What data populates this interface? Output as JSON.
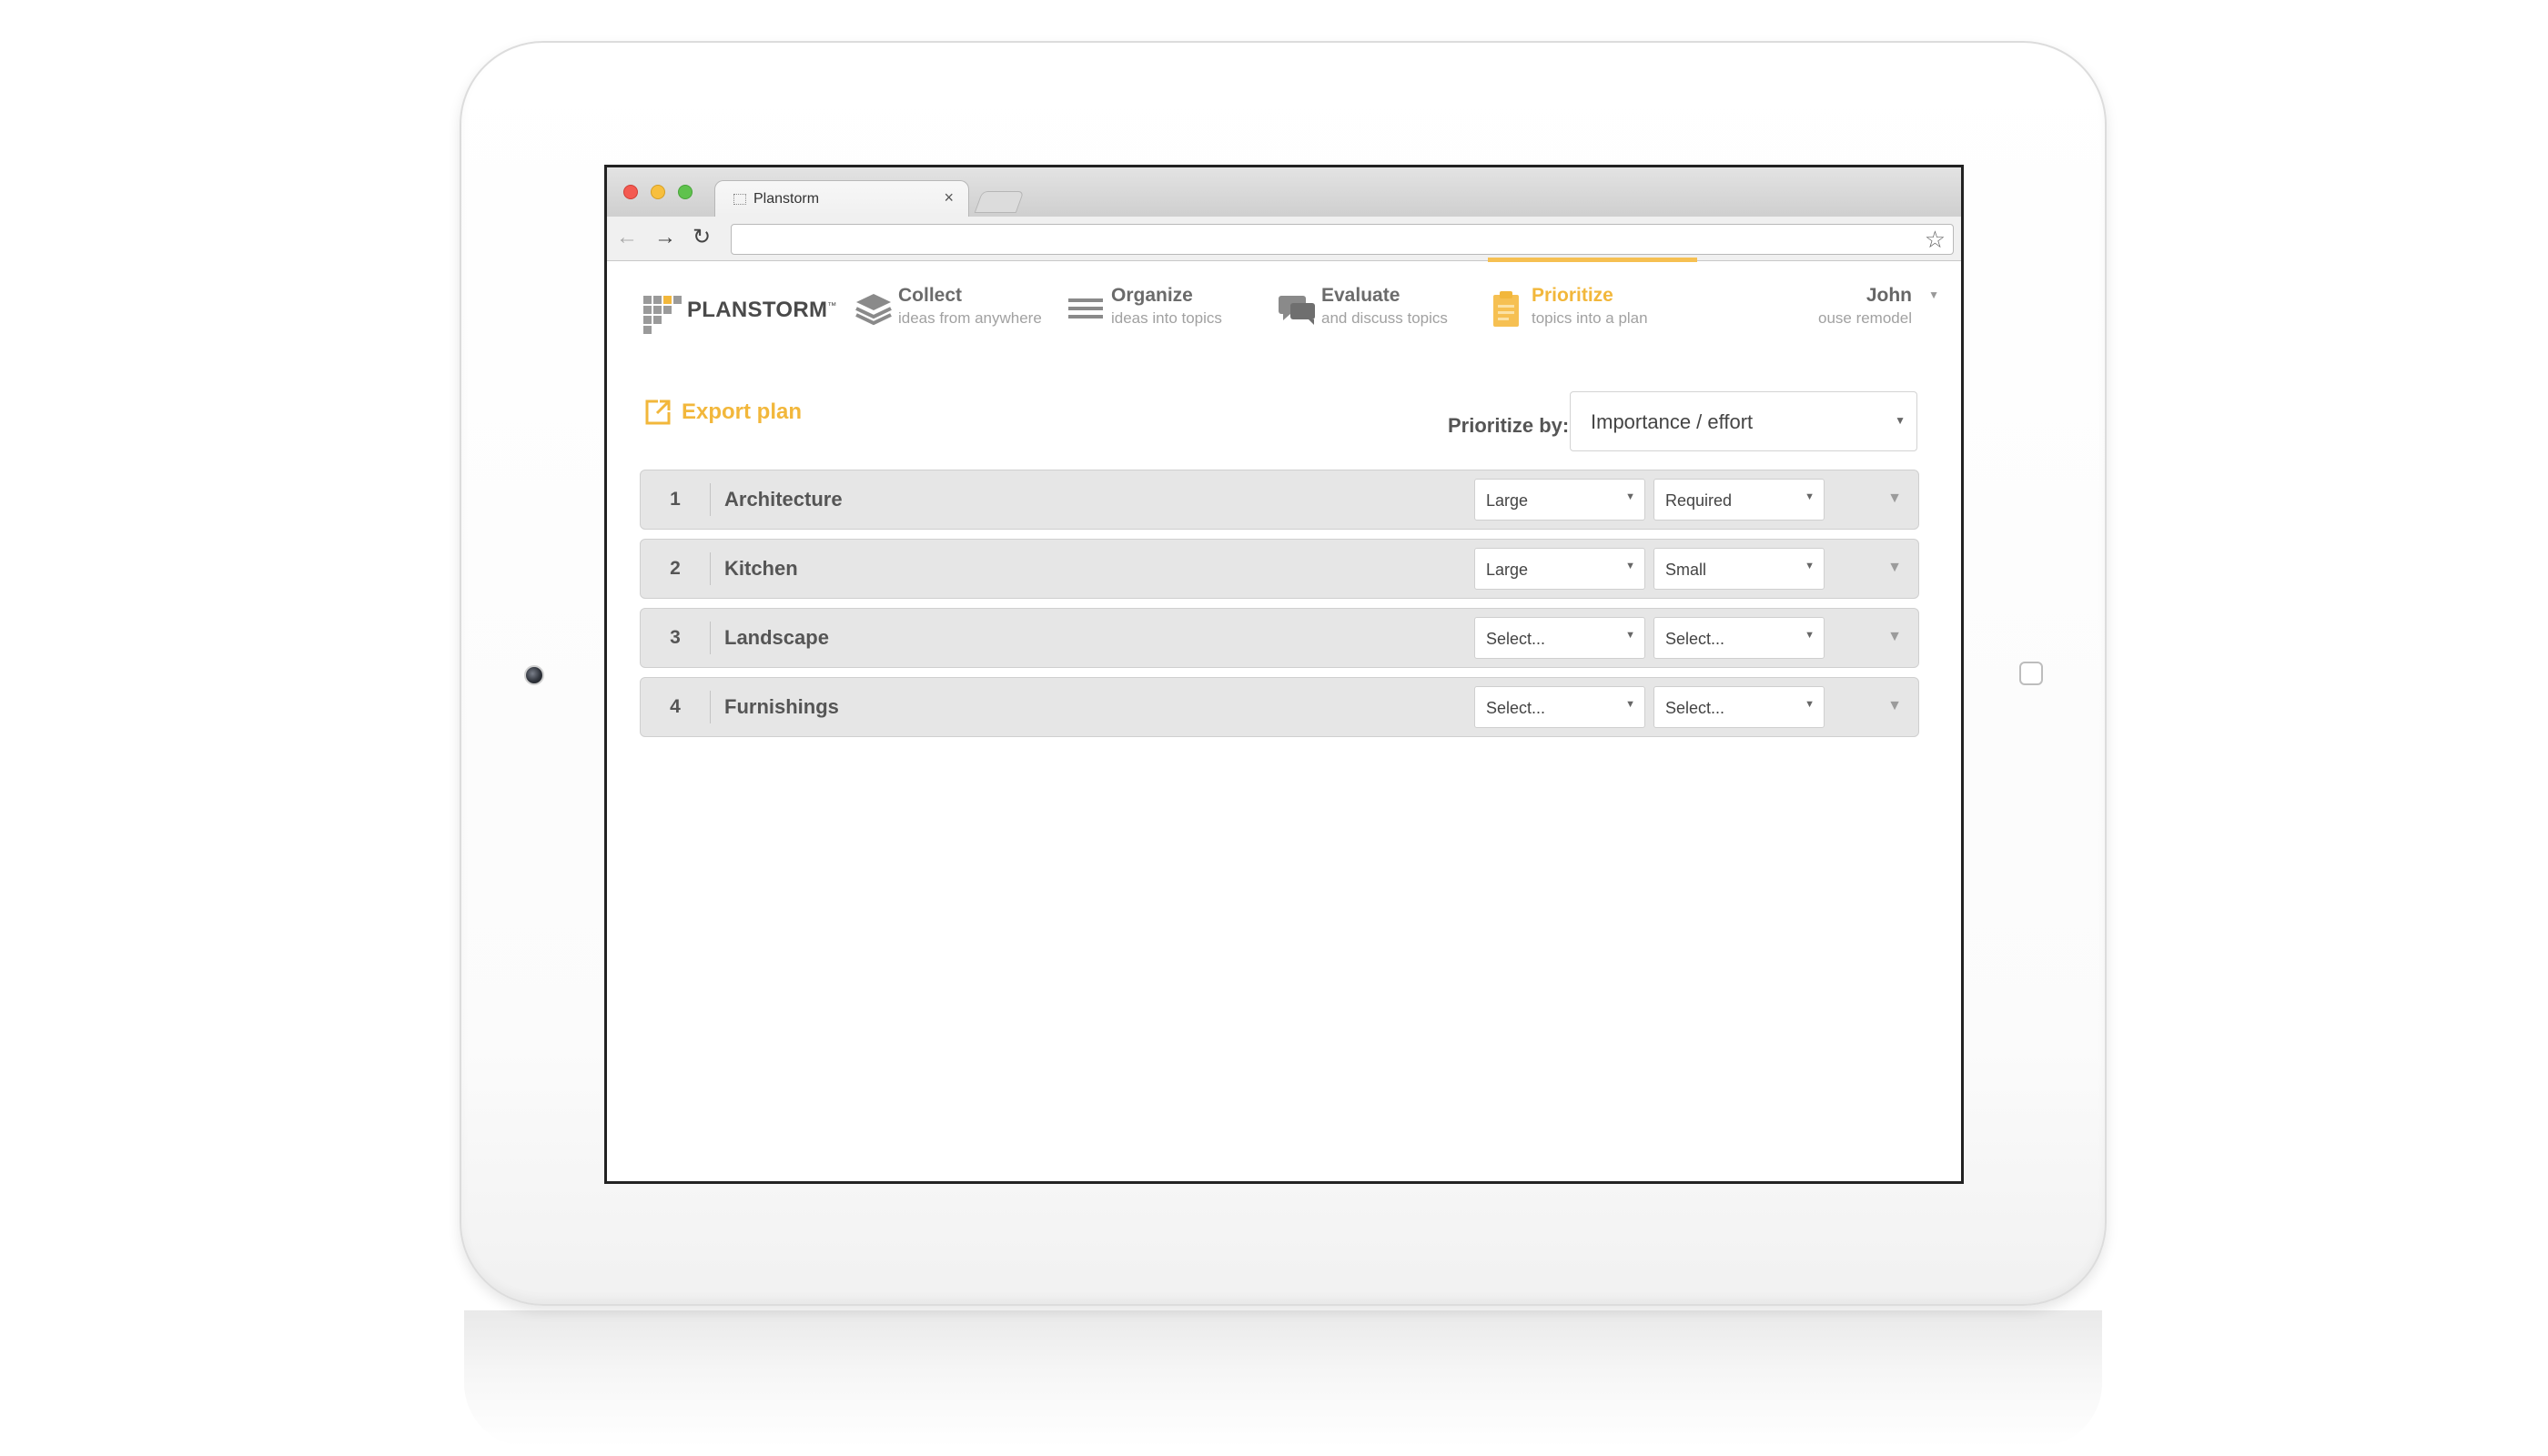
{
  "browser": {
    "tab_title": "Planstorm",
    "tab_close": "×"
  },
  "header": {
    "logo_text": "PLANSTORM",
    "logo_tm": "™",
    "steps": [
      {
        "title": "Collect",
        "subtitle": "ideas from anywhere",
        "icon": "layers-icon"
      },
      {
        "title": "Organize",
        "subtitle": "ideas into topics",
        "icon": "list-icon"
      },
      {
        "title": "Evaluate",
        "subtitle": "and discuss topics",
        "icon": "speech-bubbles-icon"
      },
      {
        "title": "Prioritize",
        "subtitle": "topics into a plan",
        "icon": "clipboard-icon",
        "active": true
      }
    ],
    "user": {
      "name": "John",
      "project": "ouse remodel"
    }
  },
  "controls": {
    "export_label": "Export plan",
    "prioritize_label": "Prioritize by:",
    "prioritize_value": "Importance / effort"
  },
  "topics": [
    {
      "num": "1",
      "name": "Architecture",
      "size": "Large",
      "need": "Required"
    },
    {
      "num": "2",
      "name": "Kitchen",
      "size": "Large",
      "need": "Small"
    },
    {
      "num": "3",
      "name": "Landscape",
      "size": "Select...",
      "need": "Select..."
    },
    {
      "num": "4",
      "name": "Furnishings",
      "size": "Select...",
      "need": "Select..."
    }
  ],
  "colors": {
    "accent": "#f2b73b",
    "row_bg": "#e6e6e6",
    "text": "#555555"
  }
}
